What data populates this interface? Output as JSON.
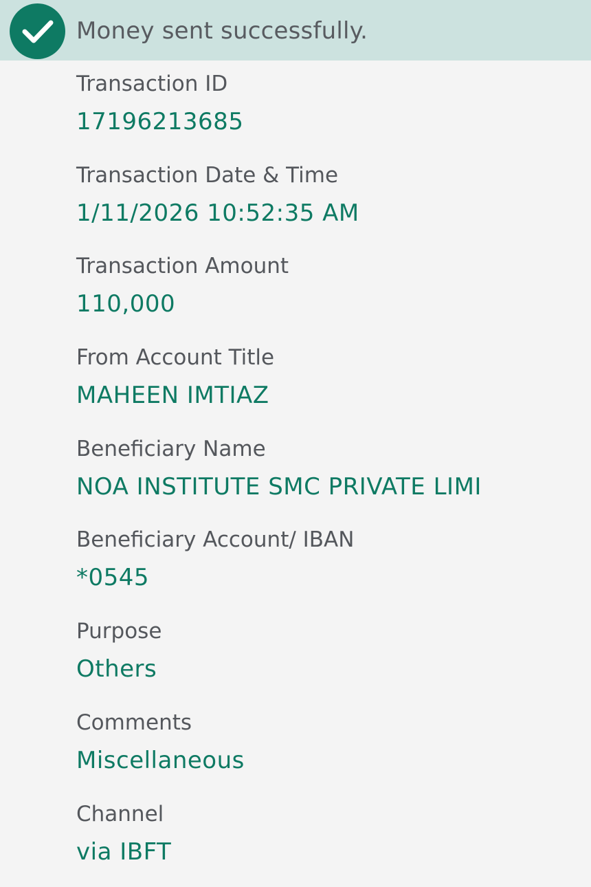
{
  "banner": {
    "icon": "check-circle-icon",
    "message": "Money sent successfully.",
    "color": "#0e7a63",
    "background": "#cce2df"
  },
  "fields": [
    {
      "label": "Transaction ID",
      "value": "17196213685"
    },
    {
      "label": "Transaction Date & Time",
      "value": "1/11/2026 10:52:35 AM"
    },
    {
      "label": "Transaction Amount",
      "value": "110,000"
    },
    {
      "label": "From Account Title",
      "value": "MAHEEN IMTIAZ"
    },
    {
      "label": "Beneficiary Name",
      "value": "NOA INSTITUTE SMC PRIVATE LIMI"
    },
    {
      "label": "Beneficiary Account/ IBAN",
      "value": "*0545"
    },
    {
      "label": "Purpose",
      "value": "Others"
    },
    {
      "label": "Comments",
      "value": "Miscellaneous"
    },
    {
      "label": "Channel",
      "value": "via IBFT"
    }
  ]
}
